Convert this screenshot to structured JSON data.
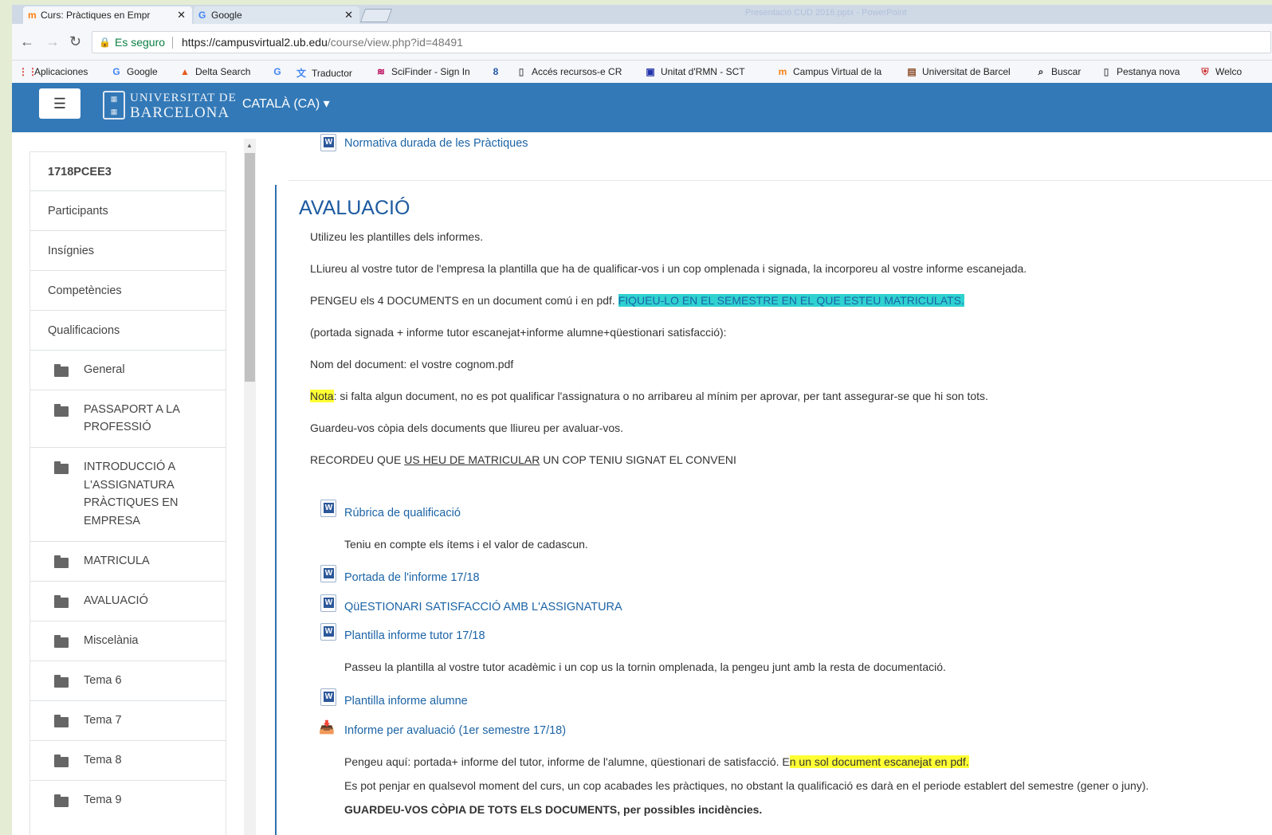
{
  "browser": {
    "tabs": [
      {
        "label": "Curs: Pràctiques en Empr",
        "close": "✕"
      },
      {
        "label": "Google",
        "close": "✕"
      }
    ],
    "blurred_title": "Presentació CUD 2016.pptx - PowerPoint",
    "secure_label": "Es seguro",
    "url_host": "https://campusvirtual2.ub.edu",
    "url_path": "/course/view.php?id=48491",
    "bookmarks": [
      "Aplicaciones",
      "Google",
      "Delta Search",
      "Traductor",
      "SciFinder - Sign In",
      "Accés recursos-e CR",
      "Unitat d'RMN - SCT",
      "Campus Virtual de la",
      "Universitat de Barcel",
      "Buscar",
      "Pestanya nova",
      "Welco"
    ]
  },
  "navbar": {
    "menu_glyph": "☰",
    "logo_line1": "UNIVERSITAT DE",
    "logo_line2": "BARCELONA",
    "language": "CATALÀ (CA) ▾"
  },
  "sidebar": {
    "top_items": [
      "1718PCEE3",
      "Participants",
      "Insígnies",
      "Competències",
      "Qualificacions"
    ],
    "sections": [
      {
        "lines": [
          "General"
        ]
      },
      {
        "lines": [
          "PASSAPORT A LA",
          "PROFESSIÓ"
        ]
      },
      {
        "lines": [
          "INTRODUCCIÓ A",
          "L'ASSIGNATURA",
          "PRÀCTIQUES EN",
          "EMPRESA"
        ]
      },
      {
        "lines": [
          "MATRICULA"
        ]
      },
      {
        "lines": [
          "AVALUACIÓ"
        ]
      },
      {
        "lines": [
          "Miscelània"
        ]
      },
      {
        "lines": [
          "Tema 6"
        ]
      },
      {
        "lines": [
          "Tema 7"
        ]
      },
      {
        "lines": [
          "Tema 8"
        ]
      },
      {
        "lines": [
          "Tema 9"
        ]
      }
    ]
  },
  "main": {
    "prev_link": "Normativa durada de les Pràctiques",
    "title": "AVALUACIÓ",
    "p1": "Utilizeu les plantilles dels informes.",
    "p2": "LLiureu al vostre tutor de l'empresa la plantilla que ha de qualificar-vos i un cop omplenada i signada, la incorporeu al vostre informe escanejada.",
    "p3_a": "PENGEU els 4 DOCUMENTS en un document comú i en pdf. ",
    "p3_b": "FIQUEU-LO EN EL SEMESTRE EN EL QUE ESTEU MATRICULATS.",
    "p4": "(portada signada + informe tutor escanejat+informe alumne+qüestionari satisfacció):",
    "p5": "Nom del document: el vostre cognom.pdf",
    "p6_a": "Nota",
    "p6_b": ": si falta algun document, no es pot qualificar l'assignatura o no arribareu al mínim per aprovar, per tant assegurar-se que hi son tots.",
    "p7": "Guardeu-vos còpia dels documents que lliureu per avaluar-vos.",
    "p8_a": "RECORDEU QUE ",
    "p8_b": "US HEU DE MATRICULAR",
    "p8_c": " UN COP TENIU SIGNAT EL CONVENI",
    "res1": "Rúbrica de qualificació",
    "res1_desc": "Teniu en compte els ítems i el valor de cadascun.",
    "res2": "Portada de l'informe 17/18",
    "res3": "QüESTIONARI SATISFACCIÓ AMB L'ASSIGNATURA",
    "res4": "Plantilla informe tutor 17/18",
    "res4_desc": "Passeu la plantilla al vostre tutor acadèmic i un cop us la tornin omplenada, la pengeu junt amb la resta de documentació.",
    "res5": "Plantilla informe alumne",
    "res6": "Informe per avaluació (1er semestre 17/18)",
    "res6_d1a": "Pengeu aquí: portada+ informe del tutor, informe de l'alumne, qüestionari de satisfacció. E",
    "res6_d1b": "n un sol document escanejat en pdf.",
    "res6_d2": "Es pot penjar en qualsevol moment del curs, un cop acabades les pràctiques, no obstant la qualificació es darà en el periode establert del semestre (gener o juny).",
    "res6_d3": "GUARDEU-VOS CÒPIA DE TOTS ELS DOCUMENTS, per possibles incidències."
  }
}
